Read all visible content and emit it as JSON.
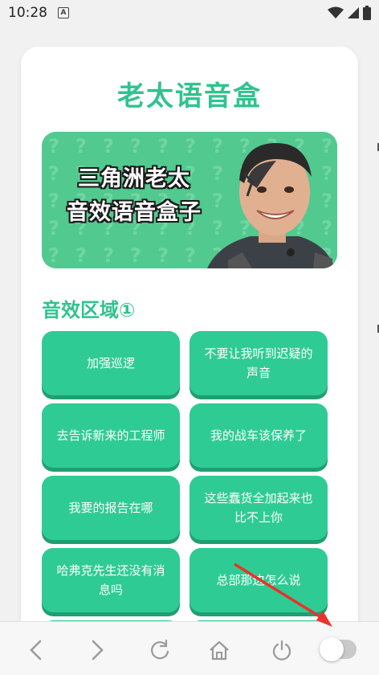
{
  "status": {
    "time": "10:28",
    "notification_icon": "A"
  },
  "header": {
    "title": "老太语音盒"
  },
  "banner": {
    "line1": "三角洲老太",
    "line2": "音效语音盒子"
  },
  "section": {
    "title": "音效区域①"
  },
  "buttons": [
    {
      "label": "加强巡逻"
    },
    {
      "label": "不要让我听到迟疑的声音"
    },
    {
      "label": "去告诉新来的工程师"
    },
    {
      "label": "我的战车该保养了"
    },
    {
      "label": "我要的报告在哪"
    },
    {
      "label": "这些蠢货全加起来也比不上你"
    },
    {
      "label": "哈弗克先生还没有消息吗"
    },
    {
      "label": "总部那边怎么说"
    }
  ],
  "nav": {
    "icons": [
      "back-icon",
      "forward-icon",
      "refresh-icon",
      "home-icon",
      "power-icon",
      "toggle-switch"
    ]
  },
  "colors": {
    "accent": "#2fc38f",
    "button": "#2fcb95",
    "banner": "#52c98e",
    "arrow": "#e8332b"
  }
}
